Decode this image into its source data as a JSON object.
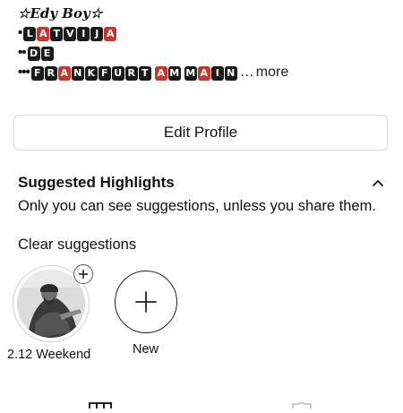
{
  "bio": {
    "name": "☆𝑬𝒅𝒚 𝑩𝒐𝒚☆",
    "lines": [
      {
        "prefix": "•",
        "tiles": [
          {
            "t": "L",
            "c": "black"
          },
          {
            "t": "A",
            "c": "red"
          },
          {
            "t": "T",
            "c": "black"
          },
          {
            "t": "V",
            "c": "black"
          },
          {
            "t": "I",
            "c": "black"
          },
          {
            "t": "J",
            "c": "black"
          },
          {
            "t": "A",
            "c": "red"
          }
        ]
      },
      {
        "prefix": "••",
        "tiles": [
          {
            "t": "D",
            "c": "black"
          },
          {
            "t": "E",
            "c": "black"
          }
        ]
      },
      {
        "prefix": "•••",
        "tiles": [
          {
            "t": "F",
            "c": "black"
          },
          {
            "t": "R",
            "c": "black"
          },
          {
            "t": "A",
            "c": "red"
          },
          {
            "t": "N",
            "c": "black"
          },
          {
            "t": "K",
            "c": "black"
          },
          {
            "t": "F",
            "c": "black"
          },
          {
            "t": "U",
            "c": "black"
          },
          {
            "t": "R",
            "c": "black"
          },
          {
            "t": "T",
            "c": "black"
          },
          {
            "t": " ",
            "c": "space"
          },
          {
            "t": "A",
            "c": "red"
          },
          {
            "t": "M",
            "c": "black"
          },
          {
            "t": " ",
            "c": "space"
          },
          {
            "t": "M",
            "c": "black"
          },
          {
            "t": "A",
            "c": "red"
          },
          {
            "t": "I",
            "c": "black"
          },
          {
            "t": "N",
            "c": "black"
          }
        ],
        "suffix": "…",
        "more": "more"
      }
    ]
  },
  "edit_profile_label": "Edit Profile",
  "suggested": {
    "title": "Suggested Highlights",
    "description": "Only you can see suggestions, unless you share them.",
    "clear_label": "Clear suggestions"
  },
  "highlights": [
    {
      "label": "2.12 Weekend"
    },
    {
      "label": "New"
    }
  ],
  "colors": {
    "tile_black": "#1a1a1a",
    "tile_red": "#c7352d",
    "border": "#d8d8d8",
    "text": "#111111"
  },
  "icons": {
    "collapse": "chevron-up-icon",
    "add_to_highlight": "plus-icon",
    "new_highlight": "plus-icon",
    "grid_tab": "grid-icon",
    "tagged_tab": "tag-person-icon"
  }
}
